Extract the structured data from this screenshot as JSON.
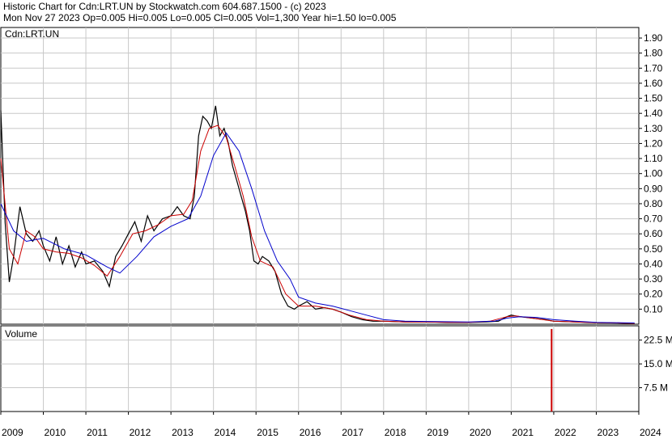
{
  "header": {
    "line1": "Historic Chart for Cdn:LRT.UN by Stockwatch.com 604.687.1500 - (c) 2023",
    "line2": "Mon Nov 27 2023   Op=0.005  Hi=0.005  Lo=0.005  Cl=0.005  Vol=1,300  Year hi=1.50  lo=0.005"
  },
  "chart_data": [
    {
      "type": "line",
      "label": "Cdn:LRT.UN",
      "x_ticks": [
        "2009",
        "2010",
        "2011",
        "2012",
        "2013",
        "2014",
        "2015",
        "2016",
        "2017",
        "2018",
        "2019",
        "2020",
        "2021",
        "2022",
        "2023",
        "2024"
      ],
      "y_ticks": [
        "0.10",
        "0.20",
        "0.30",
        "0.40",
        "0.50",
        "0.60",
        "0.70",
        "0.80",
        "0.90",
        "1.00",
        "1.10",
        "1.20",
        "1.30",
        "1.40",
        "1.50",
        "1.60",
        "1.70",
        "1.80",
        "1.90"
      ],
      "ylim": [
        0,
        1.97
      ],
      "xlim": [
        2009.0,
        2024.0
      ],
      "grid": true,
      "series": [
        {
          "color": "#000000",
          "x": [
            2009.0,
            2009.1,
            2009.2,
            2009.3,
            2009.45,
            2009.6,
            2009.75,
            2009.9,
            2010.0,
            2010.15,
            2010.3,
            2010.45,
            2010.6,
            2010.75,
            2010.9,
            2011.0,
            2011.2,
            2011.4,
            2011.55,
            2011.7,
            2011.85,
            2012.0,
            2012.15,
            2012.3,
            2012.45,
            2012.6,
            2012.8,
            2013.0,
            2013.15,
            2013.3,
            2013.45,
            2013.55,
            2013.65,
            2013.75,
            2013.85,
            2013.95,
            2014.05,
            2014.15,
            2014.25,
            2014.35,
            2014.45,
            2014.55,
            2014.65,
            2014.75,
            2014.85,
            2014.95,
            2015.05,
            2015.15,
            2015.3,
            2015.45,
            2015.6,
            2015.75,
            2015.9,
            2016.0,
            2016.2,
            2016.4,
            2016.6,
            2016.8,
            2017.0,
            2017.25,
            2017.5,
            2017.75,
            2018.0,
            2018.5,
            2019.0,
            2019.5,
            2020.0,
            2020.4,
            2020.7,
            2020.9,
            2021.0,
            2021.2,
            2021.5,
            2021.8,
            2022.0,
            2022.5,
            2023.0,
            2023.5,
            2023.9
          ],
          "y": [
            1.42,
            0.68,
            0.28,
            0.45,
            0.78,
            0.6,
            0.55,
            0.62,
            0.52,
            0.42,
            0.58,
            0.4,
            0.52,
            0.38,
            0.48,
            0.4,
            0.42,
            0.35,
            0.25,
            0.45,
            0.52,
            0.6,
            0.68,
            0.55,
            0.72,
            0.62,
            0.7,
            0.72,
            0.78,
            0.72,
            0.7,
            0.85,
            1.25,
            1.38,
            1.35,
            1.3,
            1.45,
            1.25,
            1.3,
            1.2,
            1.05,
            0.95,
            0.85,
            0.75,
            0.62,
            0.42,
            0.4,
            0.45,
            0.42,
            0.35,
            0.2,
            0.12,
            0.1,
            0.12,
            0.15,
            0.1,
            0.11,
            0.1,
            0.08,
            0.05,
            0.03,
            0.02,
            0.02,
            0.015,
            0.015,
            0.012,
            0.012,
            0.015,
            0.02,
            0.05,
            0.06,
            0.05,
            0.04,
            0.03,
            0.02,
            0.015,
            0.01,
            0.008,
            0.005
          ]
        },
        {
          "color": "#cc0000",
          "x": [
            2009.0,
            2009.2,
            2009.4,
            2009.6,
            2009.8,
            2010.0,
            2010.3,
            2010.6,
            2010.9,
            2011.2,
            2011.5,
            2011.8,
            2012.1,
            2012.4,
            2012.7,
            2013.0,
            2013.3,
            2013.5,
            2013.7,
            2013.9,
            2014.1,
            2014.3,
            2014.5,
            2014.7,
            2014.9,
            2015.1,
            2015.4,
            2015.7,
            2016.0,
            2016.4,
            2016.8,
            2017.2,
            2017.6,
            2018.0,
            2018.5,
            2019.0,
            2019.5,
            2020.0,
            2020.5,
            2020.9,
            2021.1,
            2021.5,
            2022.0,
            2022.5,
            2023.0,
            2023.5,
            2023.9
          ],
          "y": [
            1.1,
            0.5,
            0.4,
            0.62,
            0.58,
            0.5,
            0.48,
            0.47,
            0.44,
            0.39,
            0.32,
            0.45,
            0.6,
            0.62,
            0.66,
            0.72,
            0.73,
            0.82,
            1.15,
            1.3,
            1.32,
            1.24,
            1.05,
            0.85,
            0.58,
            0.42,
            0.38,
            0.2,
            0.12,
            0.12,
            0.1,
            0.06,
            0.03,
            0.02,
            0.015,
            0.015,
            0.012,
            0.012,
            0.02,
            0.05,
            0.055,
            0.04,
            0.02,
            0.015,
            0.01,
            0.008,
            0.005
          ]
        },
        {
          "color": "#0000cc",
          "x": [
            2009.0,
            2009.3,
            2009.6,
            2010.0,
            2010.5,
            2011.0,
            2011.5,
            2011.8,
            2012.2,
            2012.6,
            2013.0,
            2013.4,
            2013.7,
            2014.0,
            2014.3,
            2014.6,
            2014.9,
            2015.2,
            2015.5,
            2015.8,
            2016.0,
            2016.4,
            2016.8,
            2017.2,
            2017.6,
            2018.0,
            2018.5,
            2019.0,
            2020.0,
            2020.6,
            2020.9,
            2021.2,
            2021.6,
            2022.0,
            2022.5,
            2023.0,
            2023.9
          ],
          "y": [
            0.8,
            0.62,
            0.55,
            0.57,
            0.5,
            0.46,
            0.38,
            0.34,
            0.45,
            0.58,
            0.65,
            0.7,
            0.85,
            1.12,
            1.27,
            1.15,
            0.9,
            0.62,
            0.42,
            0.3,
            0.18,
            0.14,
            0.12,
            0.09,
            0.06,
            0.03,
            0.02,
            0.018,
            0.015,
            0.02,
            0.04,
            0.05,
            0.045,
            0.03,
            0.02,
            0.012,
            0.008
          ]
        }
      ]
    },
    {
      "type": "bar",
      "label": "Volume",
      "y_ticks": [
        "7.5 M",
        "15.0 M",
        "22.5 M"
      ],
      "ylim": [
        0,
        27
      ],
      "grid": true,
      "series": [
        {
          "color": "#cc0000",
          "x": [
            2021.95
          ],
          "values": [
            26.0
          ]
        }
      ]
    }
  ]
}
